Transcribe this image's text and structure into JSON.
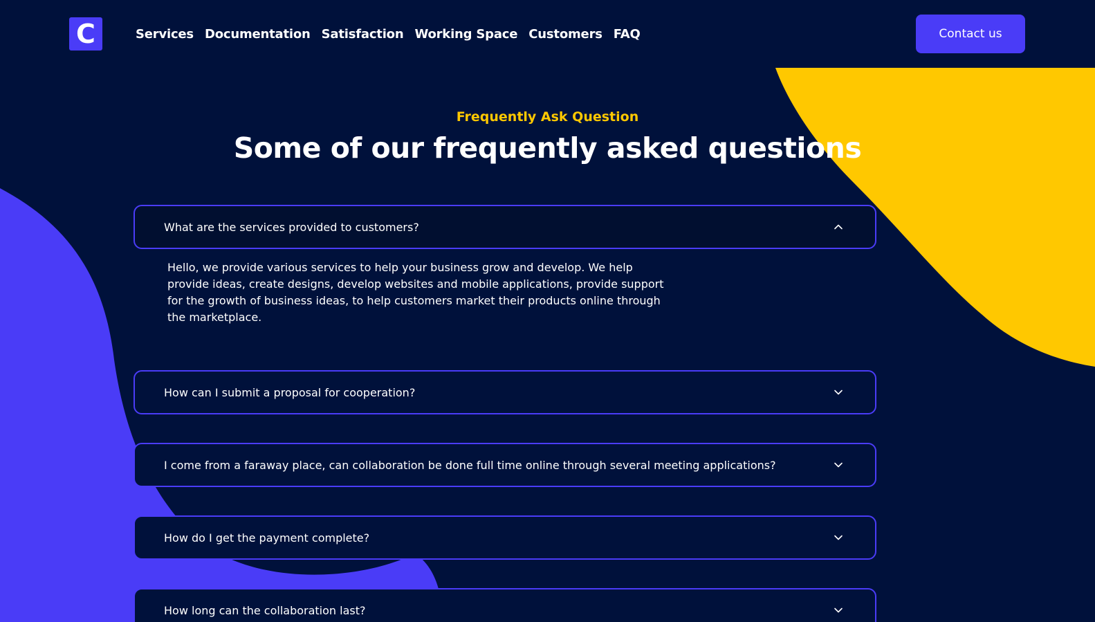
{
  "colors": {
    "background": "#00113b",
    "accent_purple": "#4a3cf7",
    "accent_yellow": "#ffc800",
    "text": "#ffffff"
  },
  "header": {
    "logo_letter": "C",
    "nav_items": [
      {
        "label": "Services"
      },
      {
        "label": "Documentation"
      },
      {
        "label": "Satisfaction"
      },
      {
        "label": "Working Space"
      },
      {
        "label": "Customers"
      },
      {
        "label": "FAQ"
      }
    ],
    "contact_label": "Contact us"
  },
  "faq": {
    "eyebrow": "Frequently Ask Question",
    "title": "Some of our frequently asked questions",
    "items": [
      {
        "question": "What are the services provided to customers?",
        "expanded": true,
        "icon": "chevron-up-icon",
        "answer": "Hello, we provide various services to help your business grow and develop. We help provide ideas, create designs, develop websites and mobile applications, provide support for the growth of business ideas, to help customers market their products online through the marketplace."
      },
      {
        "question": "How can I submit a proposal for cooperation?",
        "expanded": false,
        "icon": "chevron-down-icon"
      },
      {
        "question": "I come from a faraway place, can collaboration be done full time online through several meeting applications?",
        "expanded": false,
        "icon": "chevron-down-icon"
      },
      {
        "question": "How do I get the payment complete?",
        "expanded": false,
        "icon": "chevron-down-icon"
      },
      {
        "question": "How long can the collaboration last?",
        "expanded": false,
        "icon": "chevron-down-icon"
      }
    ]
  }
}
